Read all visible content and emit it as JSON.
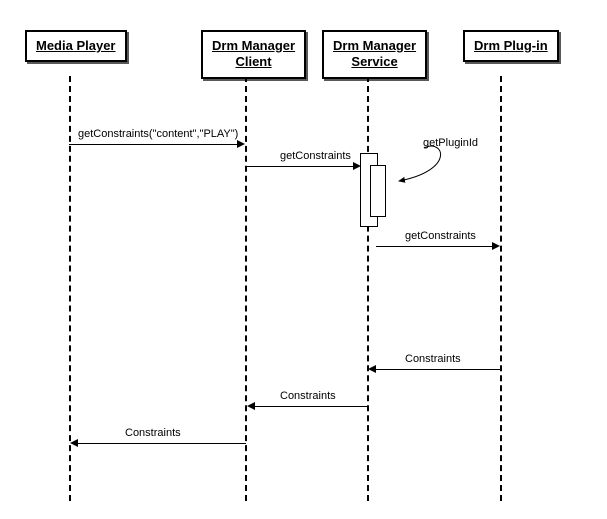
{
  "chart_data": {
    "type": "sequence-diagram",
    "participants": [
      "Media Player",
      "Drm Manager Client",
      "Drm Manager Service",
      "Drm Plug-in"
    ],
    "messages": [
      {
        "from": "Media Player",
        "to": "Drm Manager Client",
        "label": "getConstraints(\"content\",\"PLAY\")",
        "direction": "request"
      },
      {
        "from": "Drm Manager Client",
        "to": "Drm Manager Service",
        "label": "getConstraints",
        "direction": "request"
      },
      {
        "from": "Drm Manager Service",
        "to": "Drm Manager Service",
        "label": "getPluginId",
        "direction": "self"
      },
      {
        "from": "Drm Manager Service",
        "to": "Drm Plug-in",
        "label": "getConstraints",
        "direction": "request"
      },
      {
        "from": "Drm Plug-in",
        "to": "Drm Manager Service",
        "label": "Constraints",
        "direction": "response"
      },
      {
        "from": "Drm Manager Service",
        "to": "Drm Manager Client",
        "label": "Constraints",
        "direction": "response"
      },
      {
        "from": "Drm Manager Client",
        "to": "Media Player",
        "label": "Constraints",
        "direction": "response"
      }
    ]
  },
  "participants": {
    "p1": "Media Player",
    "p2": "Drm Manager\nClient",
    "p3": "Drm Manager\nService",
    "p4": "Drm Plug-in"
  },
  "labels": {
    "m1": "getConstraints(\"content\",\"PLAY\")",
    "m2": "getConstraints",
    "m3": "getPluginId",
    "m4": "getConstraints",
    "r1": "Constraints",
    "r2": "Constraints",
    "r3": "Constraints"
  }
}
